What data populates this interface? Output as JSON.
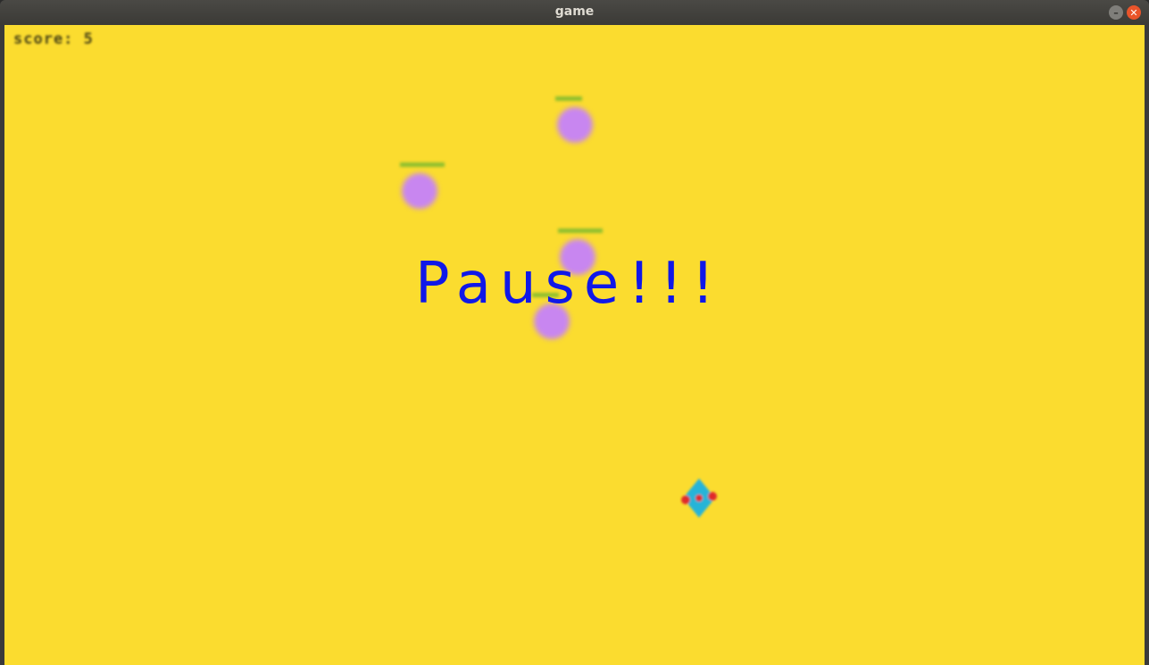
{
  "window": {
    "title": "game",
    "minimize_label": "–",
    "close_label": "✕"
  },
  "hud": {
    "score_text": "score: 5"
  },
  "overlay": {
    "pause_text": "Pause!!!"
  },
  "colors": {
    "background": "#fbdc2f",
    "pause_text": "#1018e8",
    "enemy": "#c886f0",
    "enemy_health": "#8dbf2e",
    "player_body": "#28b4d8",
    "player_accent": "#e02c2c"
  },
  "enemies": [
    {
      "name": "enemy-1",
      "health": 0.6
    },
    {
      "name": "enemy-2",
      "health": 1.0
    },
    {
      "name": "enemy-3",
      "health": 1.0
    },
    {
      "name": "enemy-4",
      "health": 0.6
    }
  ],
  "player": {
    "icon": "diamond-ship-icon"
  }
}
